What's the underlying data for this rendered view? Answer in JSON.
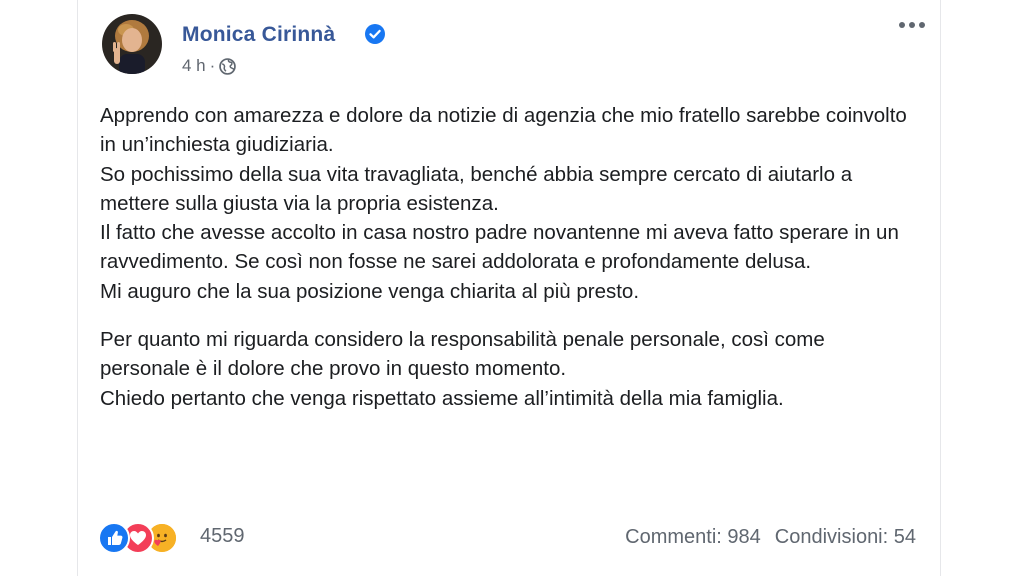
{
  "post": {
    "author": "Monica Cirinnà",
    "time": "4 h",
    "separator": "·",
    "paragraphs": [
      [
        "Apprendo con amarezza e dolore da notizie di agenzia che mio fratello sarebbe coinvolto in un’inchiesta giudiziaria.",
        "So pochissimo della sua vita travagliata, benché abbia sempre cercato di aiutarlo a mettere sulla giusta via la propria esistenza.",
        "Il fatto che avesse accolto in casa nostro padre novantenne mi aveva fatto sperare in un ravvedimento. Se così non fosse ne sarei addolorata e profondamente delusa.",
        "Mi auguro che la sua posizione venga chiarita al più presto."
      ],
      [
        "Per quanto mi riguarda considero la responsabilità penale personale, così come personale è il dolore che provo in questo momento.",
        "Chiedo pertanto che venga rispettato assieme all’intimità della mia famiglia."
      ]
    ]
  },
  "reactions": {
    "count": "4559",
    "icons": [
      "like-icon",
      "love-icon",
      "care-icon"
    ]
  },
  "stats": {
    "comments": "Commenti: 984",
    "shares": "Condivisioni: 54"
  },
  "colors": {
    "author": "#385898",
    "text": "#1c1e21",
    "secondary": "#606770",
    "like": "#1877f2",
    "love": "#f33e58",
    "care": "#f7b125"
  }
}
